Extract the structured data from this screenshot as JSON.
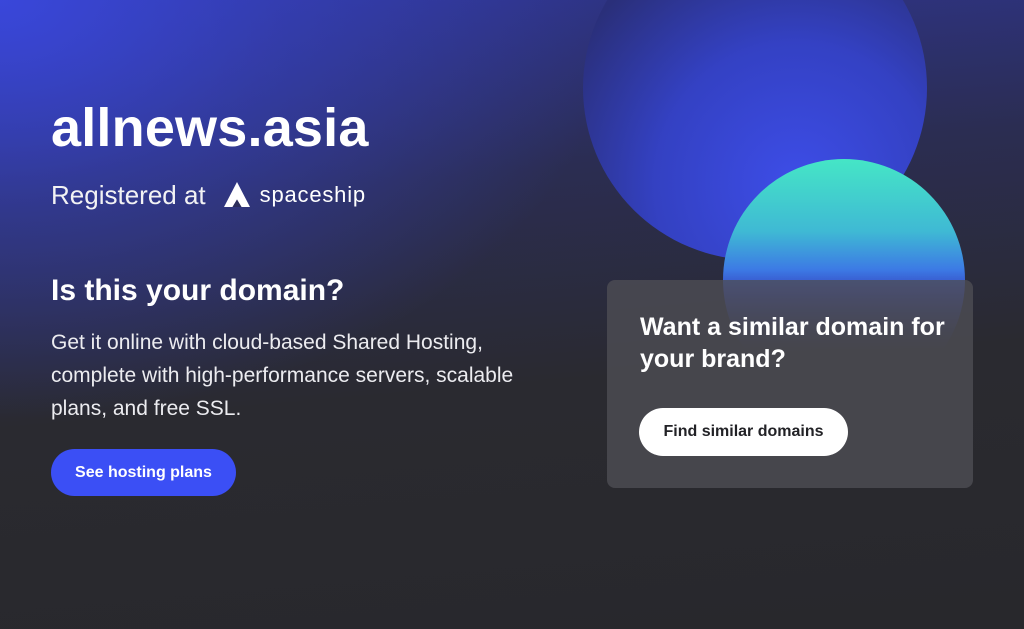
{
  "hero": {
    "domain": "allnews.asia",
    "registered_text": "Registered at",
    "registrar_name": "spaceship",
    "registrar_logo_icon": "spaceship-logo-icon",
    "question": "Is this your domain?",
    "description": "Get it online with cloud-based Shared Hosting, complete with high-performance servers, scalable plans, and free SSL.",
    "primary_button_label": "See hosting plans"
  },
  "card": {
    "title": "Want a similar domain for your brand?",
    "button_label": "Find similar domains"
  },
  "colors": {
    "primary_button": "#3b4ff5",
    "background_dark": "#28282c",
    "accent_blue": "#3a48de",
    "accent_teal": "#3fe3c4"
  }
}
